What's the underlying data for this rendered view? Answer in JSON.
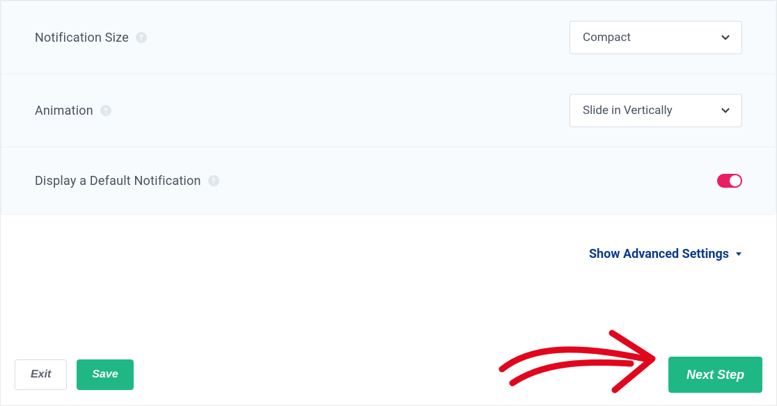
{
  "settings": {
    "rows": [
      {
        "label": "Notification Size",
        "value": "Compact",
        "control": "select"
      },
      {
        "label": "Animation",
        "value": "Slide in Vertically",
        "control": "select"
      },
      {
        "label": "Display a Default Notification",
        "value": true,
        "control": "toggle"
      }
    ]
  },
  "advanced_link": "Show Advanced Settings",
  "footer": {
    "exit": "Exit",
    "save": "Save",
    "next": "Next Step"
  }
}
